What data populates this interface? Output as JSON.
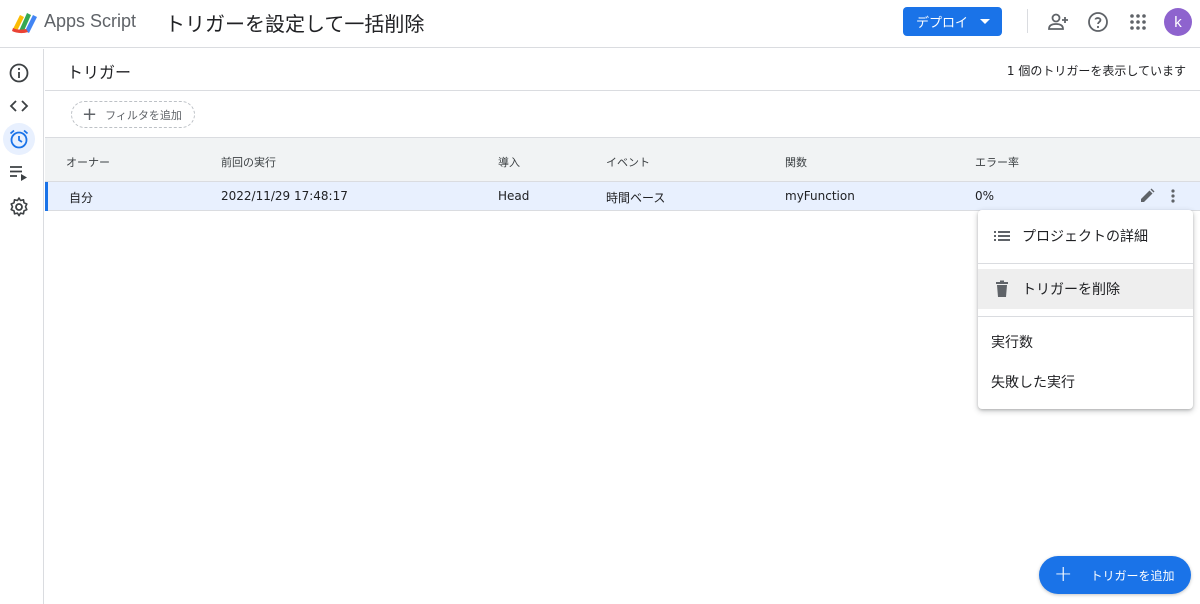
{
  "header": {
    "app_name": "Apps Script",
    "project_title": "トリガーを設定して一括削除",
    "deploy_label": "デプロイ",
    "avatar_initial": "k",
    "accent_color": "#1a73e8",
    "avatar_color": "#8e63ce"
  },
  "sidebar": {
    "items": [
      {
        "name": "overview",
        "icon": "info-icon"
      },
      {
        "name": "editor",
        "icon": "code-icon"
      },
      {
        "name": "triggers",
        "icon": "alarm-clock-icon",
        "active": true
      },
      {
        "name": "executions",
        "icon": "playlist-play-icon"
      },
      {
        "name": "settings",
        "icon": "gear-icon"
      }
    ]
  },
  "main": {
    "title": "トリガー",
    "count_text": "1 個のトリガーを表示しています",
    "filter_label": "フィルタを追加"
  },
  "table": {
    "headers": [
      "オーナー",
      "前回の実行",
      "導入",
      "イベント",
      "関数",
      "エラー率"
    ],
    "rows": [
      [
        "自分",
        "2022/11/29 17:48:17",
        "Head",
        "時間ベース",
        "myFunction",
        "0%"
      ]
    ]
  },
  "menu": {
    "items": [
      {
        "label": "プロジェクトの詳細",
        "icon": "list-icon"
      },
      {
        "label": "トリガーを削除",
        "icon": "trash-icon",
        "highlighted": true
      },
      {
        "label": "実行数"
      },
      {
        "label": "失敗した実行"
      }
    ]
  },
  "fab": {
    "label": "トリガーを追加"
  }
}
